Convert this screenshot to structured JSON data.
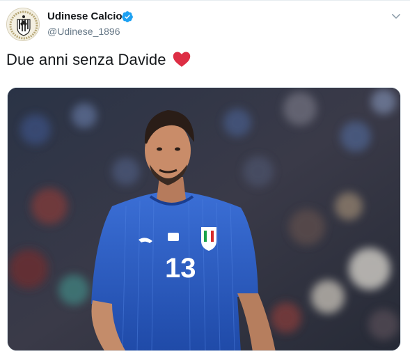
{
  "account": {
    "display_name": "Udinese Calcio",
    "handle": "@Udinese_1896",
    "verified": true
  },
  "tweet": {
    "text": "Due anni senza Davide",
    "emoji": "red-heart"
  },
  "media": {
    "kind": "photo",
    "jersey_number": "13"
  },
  "icons": {
    "verified": "verified-badge-icon",
    "menu": "chevron-down-icon",
    "avatar": "udinese-crest-logo"
  },
  "colors": {
    "verified_blue": "#1da1f2",
    "heart_red": "#dd2e44",
    "handle_gray": "#657786",
    "jersey_blue": "#2c5cc5"
  }
}
